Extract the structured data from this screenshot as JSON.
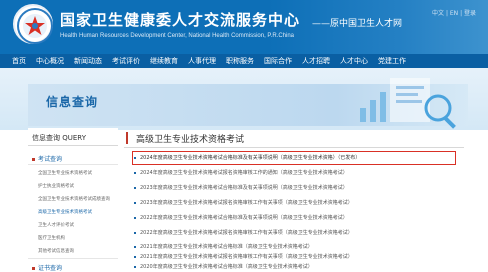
{
  "header": {
    "title_cn": "国家卫生健康委人才交流服务中心",
    "title_en": "Health Human Resources Development Center, National Health Commission, P.R.China",
    "subtitle": "——原中国卫生人才网",
    "topright": "中文 | EN | 登录",
    "logo_icon": "emblem-icon"
  },
  "nav": {
    "items": [
      "首页",
      "中心概况",
      "新闻动态",
      "考试评价",
      "继续教育",
      "人事代理",
      "职称服务",
      "国际合作",
      "人才招聘",
      "人才中心",
      "党建工作"
    ]
  },
  "banner": {
    "title": "信息查询"
  },
  "sidebar": {
    "head": "信息查询 QUERY",
    "section1": "考试查询",
    "links": [
      "全国卫生专业技术资格考试",
      "护士执业资格考试",
      "全国卫生专业技术资格考试成绩查询",
      "高级卫生专业技术资格考试",
      "卫生人才评价考试",
      "医疗卫生机构",
      "其他考试信息查询"
    ],
    "active_index": 3,
    "section2": "证书查询"
  },
  "main": {
    "title": "高级卫生专业技术资格考试",
    "rows": [
      "2024年度高级卫生专业技术资格考试合格标准及有关事项说明（高级卫生专业技术资格）（已发布）",
      "2024年度高级卫生专业技术资格考试报名资格审核工作的通知（高级卫生专业技术资格考试）",
      "2023年度高级卫生专业技术资格考试合格标准及有关事项说明（高级卫生专业技术资格考试）",
      "2023年度高级卫生专业技术资格考试报名资格审核工作有关事项（高级卫生专业技术资格考试）",
      "2022年度高级卫生专业技术资格考试合格标准及有关事项说明（高级卫生专业技术资格考试）",
      "2022年度高级卫生专业技术资格考试报名资格审核工作有关事项（高级卫生专业技术资格考试）",
      "2021年度高级卫生专业技术资格考试合格标准（高级卫生专业技术资格考试）",
      "2021年度高级卫生专业技术资格考试报名资格审核工作有关事项（高级卫生专业技术资格考试）",
      "2020年度高级卫生专业技术资格考试合格标准（高级卫生专业技术资格考试）"
    ],
    "highlight_index": 0
  },
  "colors": {
    "header_blue": "#0d6fb7",
    "nav_blue": "#0a5fa3",
    "accent_red": "#d93025"
  }
}
